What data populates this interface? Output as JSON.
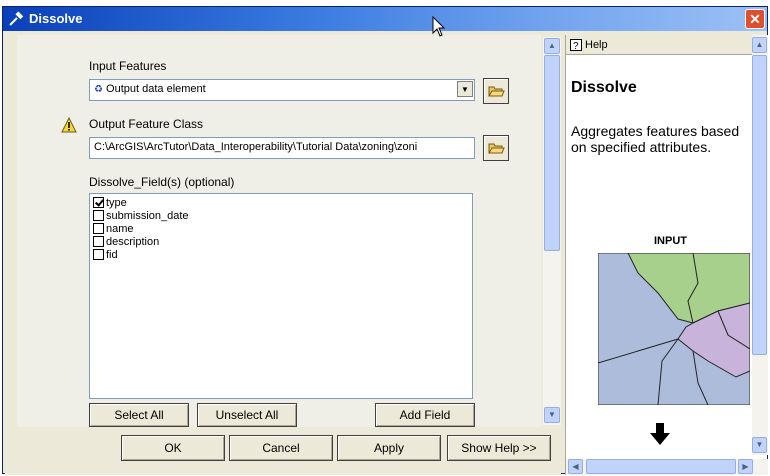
{
  "window": {
    "title": "Dissolve",
    "close_label": "✕"
  },
  "form": {
    "input_features": {
      "label": "Input Features",
      "value": "Output data element"
    },
    "output_feature_class": {
      "label": "Output Feature Class",
      "value": "C:\\ArcGIS\\ArcTutor\\Data_Interoperability\\Tutorial Data\\zoning\\zoni"
    },
    "dissolve_fields": {
      "label": "Dissolve_Field(s) (optional)",
      "items": [
        {
          "label": "type",
          "checked": true
        },
        {
          "label": "submission_date",
          "checked": false
        },
        {
          "label": "name",
          "checked": false
        },
        {
          "label": "description",
          "checked": false
        },
        {
          "label": "fid",
          "checked": false
        }
      ]
    },
    "buttons": {
      "select_all": "Select All",
      "unselect_all": "Unselect All",
      "add_field": "Add Field"
    }
  },
  "footer": {
    "ok": "OK",
    "cancel": "Cancel",
    "apply": "Apply",
    "show_help": "Show Help >>"
  },
  "help": {
    "header": "Help",
    "title": "Dissolve",
    "description": "Aggregates features based on specified attributes.",
    "input_label": "INPUT"
  },
  "colors": {
    "map_blue": "#AEBCDC",
    "map_green": "#A8D08D",
    "map_purple": "#C8B4DA"
  }
}
